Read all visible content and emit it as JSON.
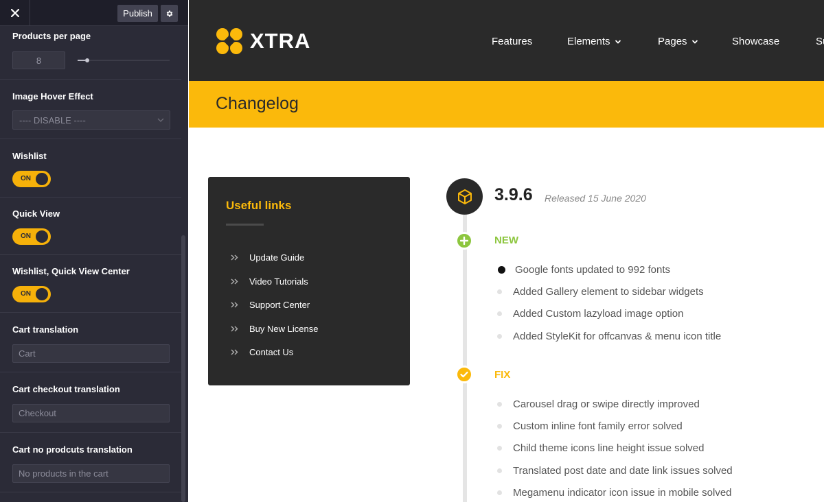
{
  "sidebar": {
    "publish_label": "Publish",
    "products_per_page": {
      "label": "Products per page",
      "value": "8",
      "level": 0.08
    },
    "image_hover": {
      "label": "Image Hover Effect",
      "value": "---- DISABLE ----"
    },
    "wishlist": {
      "label": "Wishlist",
      "toggle": "ON"
    },
    "quick_view": {
      "label": "Quick View",
      "toggle": "ON"
    },
    "wishlist_qv_center": {
      "label": "Wishlist, Quick View Center",
      "toggle": "ON"
    },
    "cart_translation": {
      "label": "Cart translation",
      "placeholder": "Cart"
    },
    "cart_checkout": {
      "label": "Cart checkout translation",
      "placeholder": "Checkout"
    },
    "cart_no_products": {
      "label": "Cart no prodcuts translation",
      "placeholder": "No products in the cart"
    }
  },
  "header": {
    "logo_text": "XTRA",
    "nav": [
      "Features",
      "Elements",
      "Pages",
      "Showcase",
      "Su"
    ]
  },
  "title_bar": {
    "title": "Changelog"
  },
  "useful_links": {
    "title": "Useful links",
    "items": [
      "Update Guide",
      "Video Tutorials",
      "Support Center",
      "Buy New License",
      "Contact Us"
    ]
  },
  "changelog": {
    "version": "3.9.6",
    "released": "Released 15 June 2020",
    "new": {
      "label": "NEW",
      "items": [
        "Google fonts updated to 992 fonts",
        "Added Gallery element to sidebar widgets",
        "Added Custom lazyload image option",
        "Added StyleKit for offcanvas & menu icon title"
      ]
    },
    "fix": {
      "label": "FIX",
      "items": [
        "Carousel drag or swipe directly improved",
        "Custom inline font family error solved",
        "Child theme icons line height issue solved",
        "Translated post date and date link issues solved",
        "Megamenu indicator icon issue in mobile solved"
      ]
    }
  },
  "colors": {
    "accent": "#fbb90b",
    "sidebar_bg": "#2b2b37",
    "header_bg": "#2a2a2a",
    "new_green": "#8dc63f",
    "fix_yellow": "#fbb90b"
  }
}
